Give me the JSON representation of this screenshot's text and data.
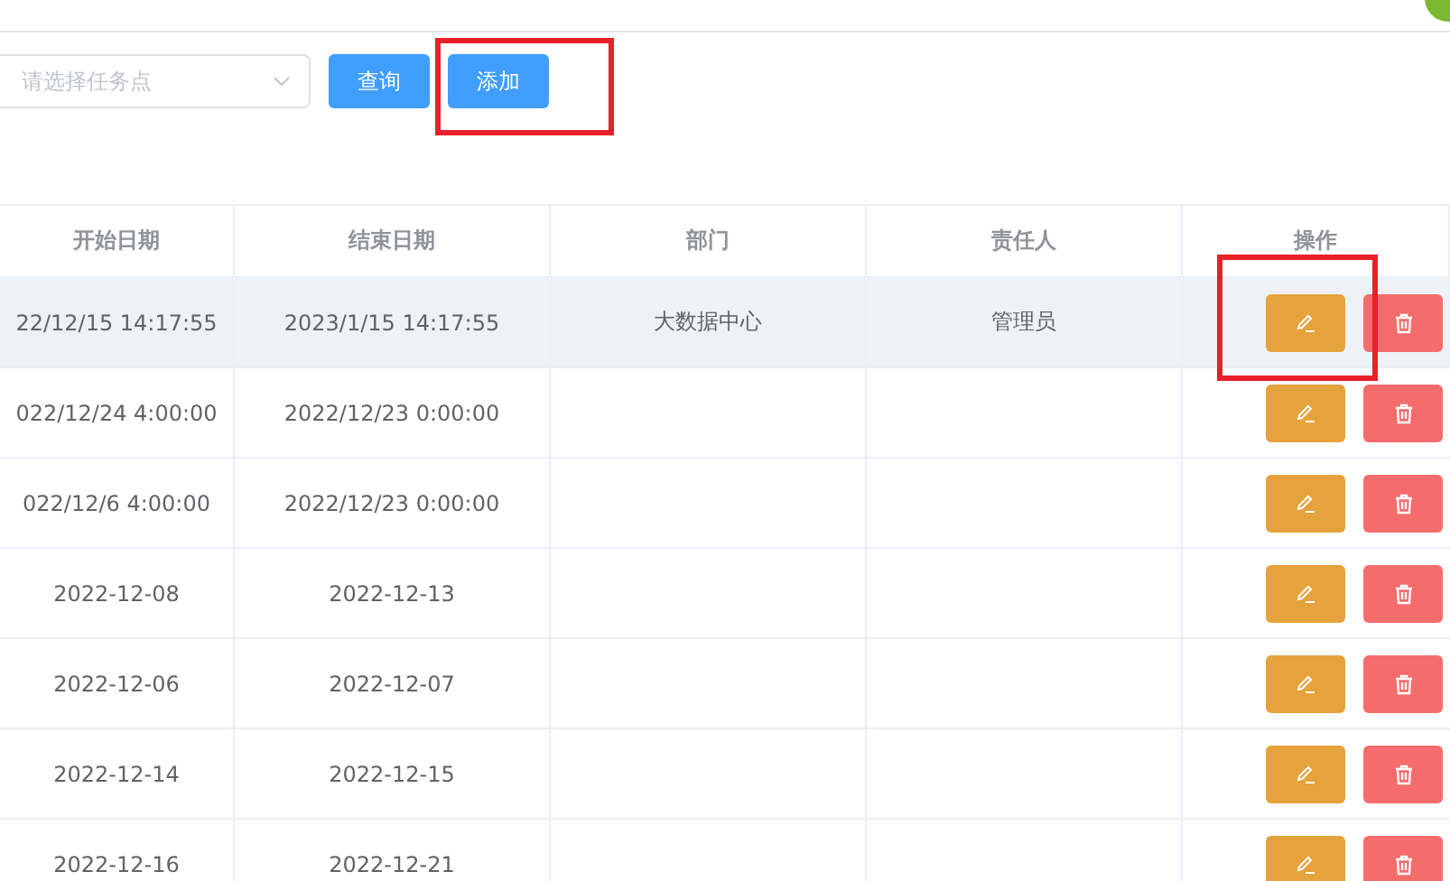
{
  "filter": {
    "placeholder": "请选择任务点"
  },
  "buttons": [
    {
      "label": "查询"
    },
    {
      "label": "添加"
    }
  ],
  "table": {
    "columns": [
      "开始日期",
      "结束日期",
      "部门",
      "责任人",
      "操作"
    ],
    "rows": [
      {
        "start": "22/12/15 14:17:55",
        "end": "2023/1/15 14:17:55",
        "dept": "大数据中心",
        "owner": "管理员",
        "hovered": true
      },
      {
        "start": "022/12/24 4:00:00",
        "end": "2022/12/23 0:00:00",
        "dept": "",
        "owner": "",
        "hovered": false
      },
      {
        "start": "022/12/6 4:00:00",
        "end": "2022/12/23 0:00:00",
        "dept": "",
        "owner": "",
        "hovered": false
      },
      {
        "start": "2022-12-08",
        "end": "2022-12-13",
        "dept": "",
        "owner": "",
        "hovered": false
      },
      {
        "start": "2022-12-06",
        "end": "2022-12-07",
        "dept": "",
        "owner": "",
        "hovered": false
      },
      {
        "start": "2022-12-14",
        "end": "2022-12-15",
        "dept": "",
        "owner": "",
        "hovered": false
      },
      {
        "start": "2022-12-16",
        "end": "2022-12-21",
        "dept": "",
        "owner": "",
        "hovered": false
      }
    ]
  }
}
